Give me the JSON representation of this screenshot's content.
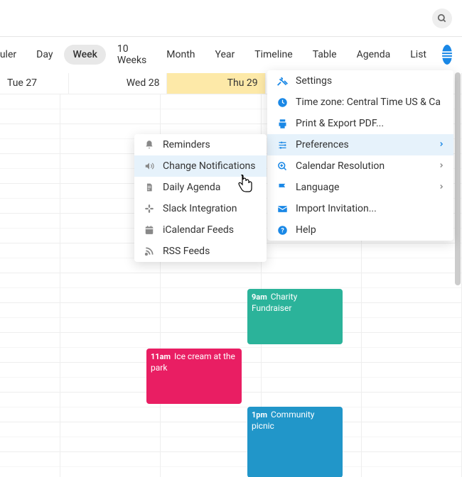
{
  "views": {
    "scheduler": "Scheduler",
    "day": "Day",
    "week": "Week",
    "ten_weeks": "10 Weeks",
    "month": "Month",
    "year": "Year",
    "timeline": "Timeline",
    "table": "Table",
    "agenda": "Agenda",
    "list": "List"
  },
  "days": {
    "tue": "Tue 27",
    "wed": "Wed 28",
    "thu": "Thu 29"
  },
  "events": {
    "icecream": {
      "time": "11am",
      "title": "Ice cream at the park"
    },
    "charity": {
      "time": "9am",
      "title": "Charity Fundraiser"
    },
    "picnic": {
      "time": "1pm",
      "title": "Community picnic"
    }
  },
  "menu": {
    "settings": "Settings",
    "timezone": "Time zone: Central Time US & Ca",
    "print": "Print & Export PDF...",
    "preferences": "Preferences",
    "resolution": "Calendar Resolution",
    "language": "Language",
    "import": "Import Invitation...",
    "help": "Help"
  },
  "submenu": {
    "reminders": "Reminders",
    "change_notifications": "Change Notifications",
    "daily_agenda": "Daily Agenda",
    "slack": "Slack Integration",
    "ical": "iCalendar Feeds",
    "rss": "RSS Feeds"
  }
}
